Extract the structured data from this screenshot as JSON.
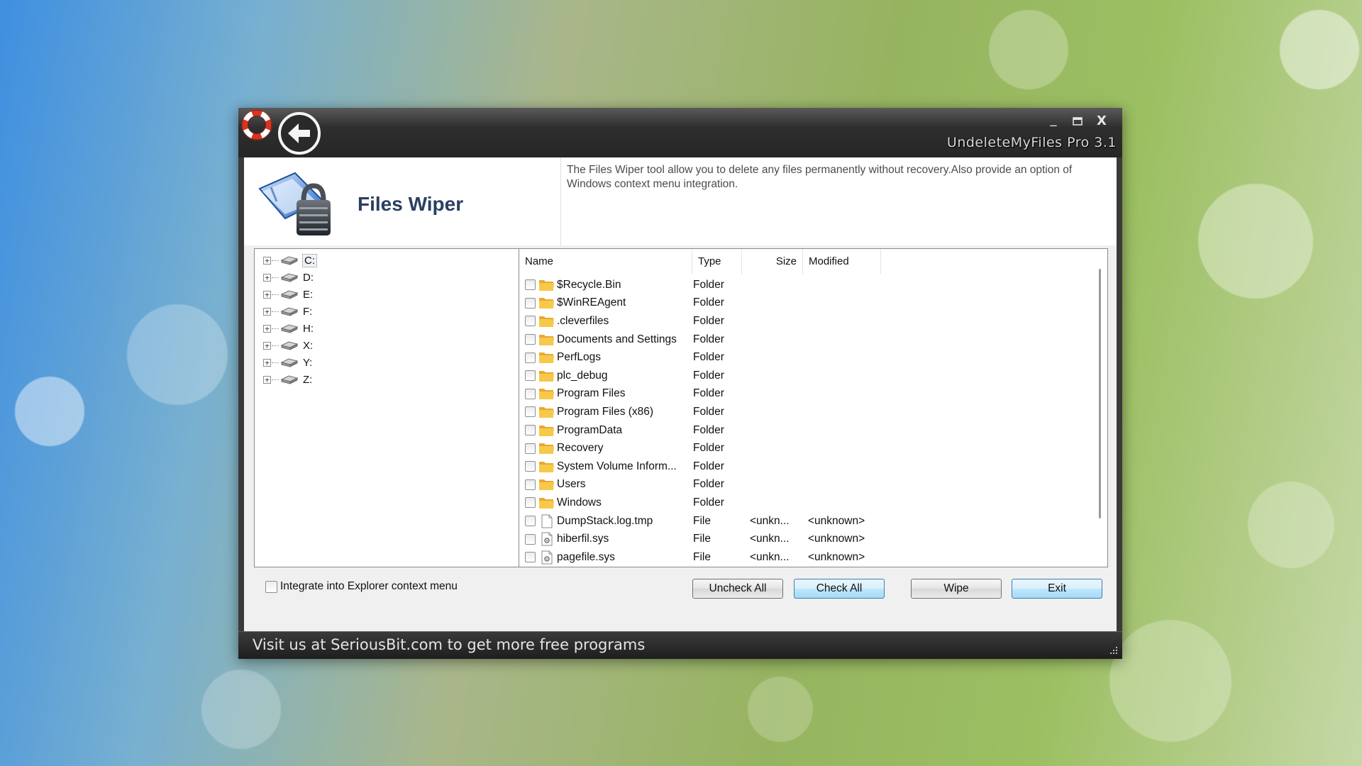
{
  "window": {
    "app_name": "UndeleteMyFiles Pro 3.1",
    "controls": {
      "minimize": "_",
      "maximize": "□",
      "close": "X"
    }
  },
  "header": {
    "title": "Files Wiper",
    "description": "The Files Wiper tool allow you to delete any files permanently without recovery.Also provide an option of Windows context menu integration."
  },
  "tree": {
    "items": [
      {
        "label": "C:",
        "expander": "+"
      },
      {
        "label": "D:",
        "expander": "+"
      },
      {
        "label": "E:",
        "expander": "+"
      },
      {
        "label": "F:",
        "expander": "+"
      },
      {
        "label": "H:",
        "expander": "+"
      },
      {
        "label": "X:",
        "expander": "+"
      },
      {
        "label": "Y:",
        "expander": "+"
      },
      {
        "label": "Z:",
        "expander": "+"
      }
    ]
  },
  "list": {
    "columns": {
      "name": "Name",
      "type": "Type",
      "size": "Size",
      "modified": "Modified"
    },
    "rows": [
      {
        "name": "$Recycle.Bin",
        "type": "Folder",
        "size": "",
        "modified": "",
        "icon": "folder-icon"
      },
      {
        "name": "$WinREAgent",
        "type": "Folder",
        "size": "",
        "modified": "",
        "icon": "folder-icon"
      },
      {
        "name": ".cleverfiles",
        "type": "Folder",
        "size": "",
        "modified": "",
        "icon": "folder-icon"
      },
      {
        "name": "Documents and Settings",
        "type": "Folder",
        "size": "",
        "modified": "",
        "icon": "folder-icon"
      },
      {
        "name": "PerfLogs",
        "type": "Folder",
        "size": "",
        "modified": "",
        "icon": "folder-icon"
      },
      {
        "name": "plc_debug",
        "type": "Folder",
        "size": "",
        "modified": "",
        "icon": "folder-icon"
      },
      {
        "name": "Program Files",
        "type": "Folder",
        "size": "",
        "modified": "",
        "icon": "folder-icon"
      },
      {
        "name": "Program Files (x86)",
        "type": "Folder",
        "size": "",
        "modified": "",
        "icon": "folder-icon"
      },
      {
        "name": "ProgramData",
        "type": "Folder",
        "size": "",
        "modified": "",
        "icon": "folder-icon"
      },
      {
        "name": "Recovery",
        "type": "Folder",
        "size": "",
        "modified": "",
        "icon": "folder-icon"
      },
      {
        "name": "System Volume Inform...",
        "type": "Folder",
        "size": "",
        "modified": "",
        "icon": "folder-icon"
      },
      {
        "name": "Users",
        "type": "Folder",
        "size": "",
        "modified": "",
        "icon": "folder-icon"
      },
      {
        "name": "Windows",
        "type": "Folder",
        "size": "",
        "modified": "",
        "icon": "folder-icon"
      },
      {
        "name": "DumpStack.log.tmp",
        "type": "File",
        "size": "<unkn...",
        "modified": "<unknown>",
        "icon": "file-icon"
      },
      {
        "name": "hiberfil.sys",
        "type": "File",
        "size": "<unkn...",
        "modified": "<unknown>",
        "icon": "system-file-icon"
      },
      {
        "name": "pagefile.sys",
        "type": "File",
        "size": "<unkn...",
        "modified": "<unknown>",
        "icon": "system-file-icon"
      }
    ]
  },
  "bottom": {
    "integrate_label": "Integrate into Explorer context menu",
    "uncheck_all": "Uncheck All",
    "check_all": "Check All",
    "wipe": "Wipe",
    "exit": "Exit"
  },
  "status": {
    "link_text": "Visit us at SeriousBit.com to get more free programs"
  },
  "colors": {
    "title_blue": "#2a3f62",
    "titlebar_dark": "#2e2e2e",
    "folder_yellow": "#f5c13b"
  }
}
